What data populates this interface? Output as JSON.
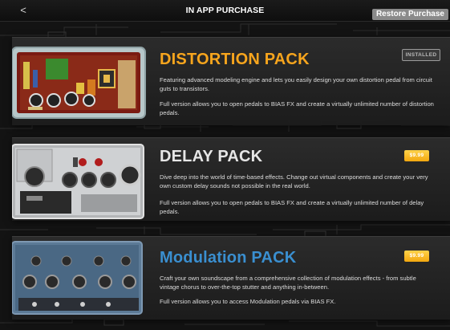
{
  "header": {
    "back_label": "<",
    "title": "IN APP PURCHASE",
    "restore_label": "Restore Purchase"
  },
  "packs": [
    {
      "title": "DISTORTION PACK",
      "title_color": "#f7a51d",
      "button_label": "INSTALLED",
      "button_state": "installed",
      "desc1": "Featuring advanced modeling engine and lets you easily design your own distortion pedal from circuit guts to transistors.",
      "desc2": "Full version allows you to open pedals to BIAS FX and create a virtually unlimited number of distortion pedals."
    },
    {
      "title": "DELAY PACK",
      "title_color": "#e6e6e6",
      "button_label": "$9.99",
      "button_state": "price",
      "desc1": "Dive deep into the world of time-based effects. Change out virtual components and create your very own custom delay sounds not possible in the real world.",
      "desc2": "Full version allows you to open pedals to BIAS FX and create a virtually unlimited number of delay pedals."
    },
    {
      "title": "Modulation PACK",
      "title_color": "#3a8fd0",
      "button_label": "$9.99",
      "button_state": "price",
      "desc1": "Craft your own soundscape from a comprehensive collection of modulation effects - from subtle vintage chorus to over-the-top stutter and anything in-between.",
      "desc2": "Full version allows you to access Modulation pedals via BIAS FX."
    }
  ]
}
